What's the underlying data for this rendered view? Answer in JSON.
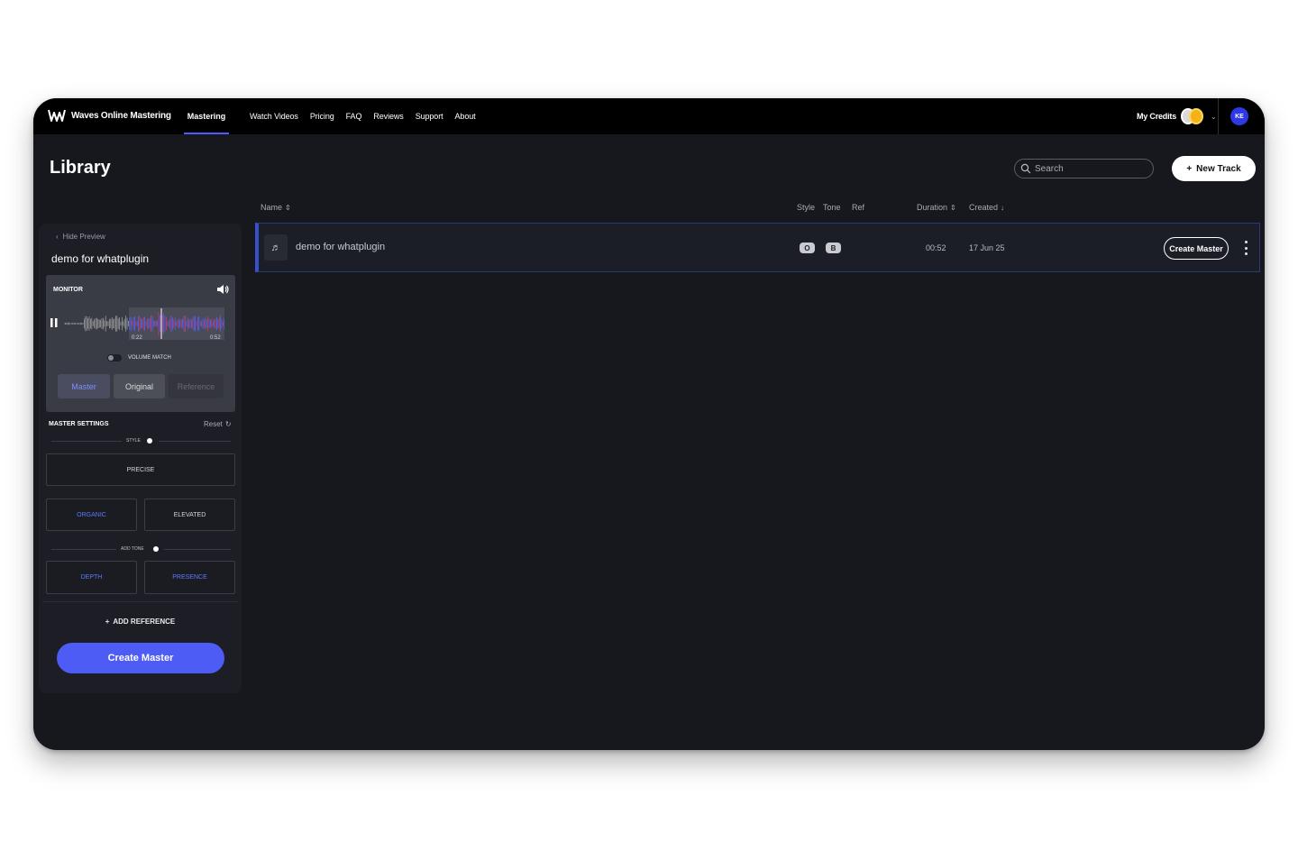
{
  "nav": {
    "brand": "Waves Online Mastering",
    "active_tab": "Mastering",
    "links": [
      "Watch Videos",
      "Pricing",
      "FAQ",
      "Reviews",
      "Support",
      "About"
    ],
    "credits_label": "My Credits",
    "avatar_initials": "KE"
  },
  "page": {
    "title": "Library",
    "search_placeholder": "Search",
    "new_track_label": "New Track",
    "new_track_prefix": "+"
  },
  "table": {
    "headers": {
      "name": "Name",
      "style": "Style",
      "tone": "Tone",
      "ref": "Ref",
      "duration": "Duration",
      "created": "Created"
    },
    "rows": [
      {
        "name": "demo for whatplugin",
        "style_badge": "O",
        "tone_badge": "B",
        "duration": "00:52",
        "created": "17 Jun 25",
        "action_label": "Create Master"
      }
    ]
  },
  "preview": {
    "hide_label": "Hide Preview",
    "track_title": "demo for whatplugin",
    "monitor_label": "MONITOR",
    "time_current": "0:22",
    "time_total": "0:52",
    "volume_match_label": "VOLUME MATCH",
    "segments": [
      "Master",
      "Original",
      "Reference"
    ],
    "selected_segment": "Master",
    "master_settings_label": "MASTER SETTINGS",
    "reset_label": "Reset",
    "style_tag": "STYLE",
    "style_options": [
      "PRECISE",
      "ORGANIC",
      "ELEVATED"
    ],
    "selected_style": "ORGANIC",
    "tone_tag": "ADD TONE",
    "tone_options": [
      "DEPTH",
      "PRESENCE"
    ],
    "selected_tones": [
      "DEPTH",
      "PRESENCE"
    ],
    "add_reference_label": "ADD REFERENCE",
    "add_reference_prefix": "+",
    "create_master_label": "Create Master"
  },
  "colors": {
    "accent": "#4e5cf6",
    "background": "#17181e",
    "topbar": "#000000",
    "selected_text": "#5a7aff"
  }
}
